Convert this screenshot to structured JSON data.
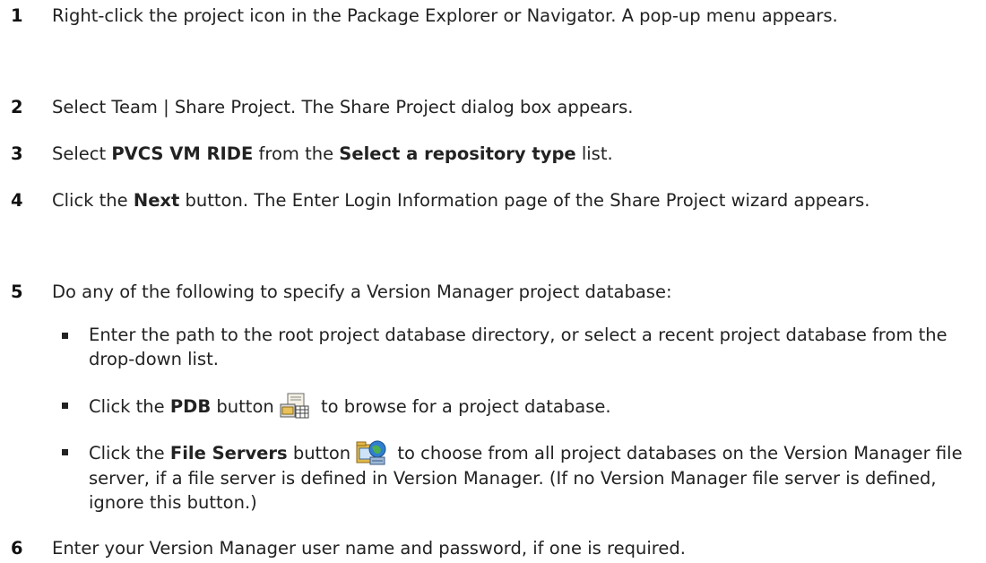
{
  "steps": [
    {
      "num": "1",
      "text": "Right-click the project icon in the Package Explorer or Navigator. A pop-up menu appears."
    },
    {
      "num": "2",
      "text": "Select Team | Share Project. The Share Project dialog box appears."
    },
    {
      "num": "3",
      "pre": "Select ",
      "bold1": "PVCS VM RIDE",
      "mid": " from the ",
      "bold2": "Select a repository type",
      "post": " list."
    },
    {
      "num": "4",
      "pre": "Click the ",
      "bold1": "Next",
      "post": " button. The Enter Login Information page of the Share Project wizard appears."
    },
    {
      "num": "5",
      "text": "Do any of the following to specify a Version Manager project database:"
    },
    {
      "num": "6",
      "text": "Enter your Version Manager user name and password, if one is required."
    }
  ],
  "bullets": [
    {
      "text": "Enter the path to the root project database directory, or select a recent project database from the drop-down list."
    },
    {
      "pre": "Click the ",
      "bold": "PDB",
      "post1": " button",
      "post2": " to browse for a project database.",
      "icon": "pdb-icon"
    },
    {
      "pre": "Click the ",
      "bold": "File Servers",
      "post1": " button",
      "post2": " to choose from all project databases on the Version Manager file server, if a file server is defined in Version Manager. (If no Version Manager file server is defined, ignore this button.)",
      "icon": "file-servers-icon"
    }
  ]
}
